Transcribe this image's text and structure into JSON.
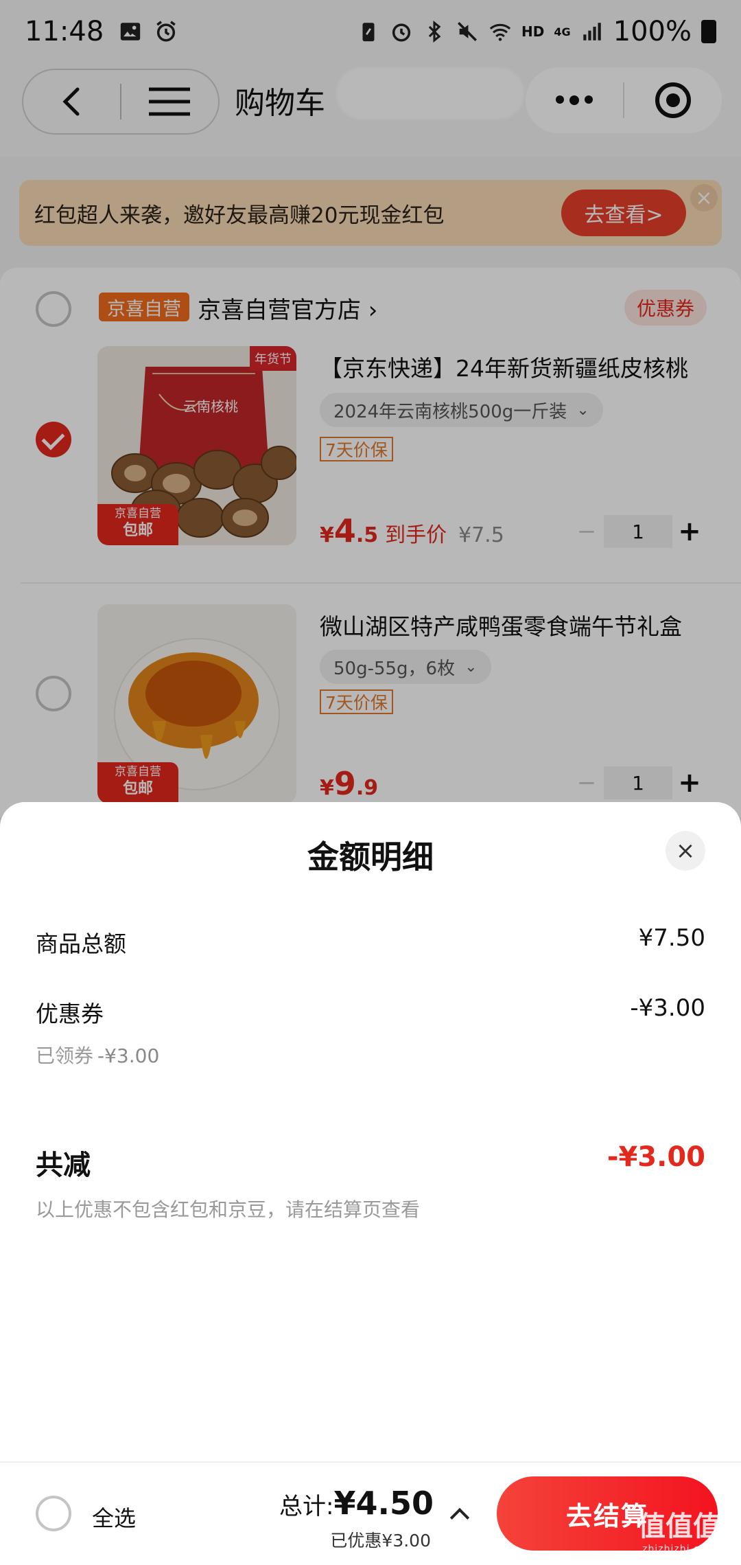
{
  "status_bar": {
    "time": "11:48",
    "network": "4G",
    "hd": "HD",
    "battery": "100%"
  },
  "nav": {
    "title": "购物车"
  },
  "promo": {
    "text": "红包超人来袭，邀好友最高赚20元现金红包",
    "button": "去查看>",
    "close": "×"
  },
  "shop": {
    "badge": "京喜自营",
    "name": "京喜自营官方店 ›",
    "coupon_tag": "优惠券"
  },
  "products": [
    {
      "title": "【京东快递】24年新货新疆纸皮核桃",
      "spec": "2024年云南核桃500g一斤装",
      "price_guard": "7天价保",
      "price_symbol": "¥",
      "price_int": "4",
      "price_dec": ".5",
      "price_label": "到手价",
      "original_price": "¥7.5",
      "qty": "1",
      "free_ship_top": "京喜自营",
      "free_ship": "包邮",
      "package_label": "云南核桃",
      "festival_tag": "年货节",
      "checked": true
    },
    {
      "title": "微山湖区特产咸鸭蛋零食端午节礼盒",
      "spec": "50g-55g，6枚",
      "price_guard": "7天价保",
      "price_symbol": "¥",
      "price_int": "9",
      "price_dec": ".9",
      "qty": "1",
      "free_ship_top": "京喜自营",
      "free_ship": "包邮",
      "checked": false
    }
  ],
  "sheet": {
    "title": "金额明细",
    "close": "×",
    "goods_total_label": "商品总额",
    "goods_total_value": "¥7.50",
    "coupon_label": "优惠券",
    "coupon_value": "-¥3.00",
    "coupon_sub_label": "已领券",
    "coupon_sub_value": "-¥3.00",
    "total_reduce_label": "共减",
    "total_reduce_value": "-¥3.00",
    "note": "以上优惠不包含红包和京豆，请在结算页查看"
  },
  "footer": {
    "select_all": "全选",
    "total_prefix": "总计:",
    "total_amount": "¥4.50",
    "discount": "已优惠¥3.00",
    "checkout": "去结算"
  },
  "watermark": {
    "main": "值值值",
    "sub": "zhizhizhi.com"
  },
  "colors": {
    "accent_red": "#e3281c",
    "promo_bg": "#f8dcb7",
    "shop_badge": "#f26b1d"
  }
}
